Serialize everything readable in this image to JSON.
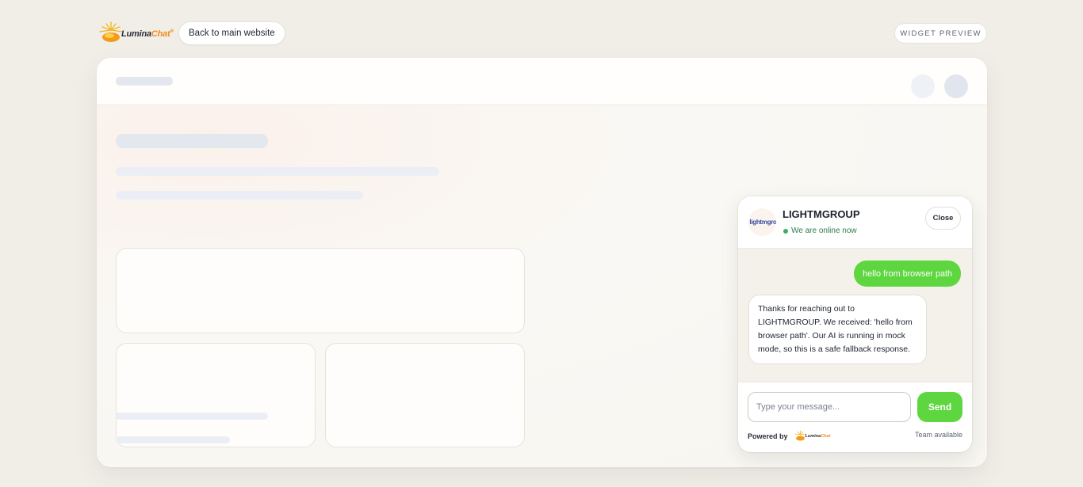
{
  "topbar": {
    "logo": {
      "part1": "Lumina",
      "part2": "Chat",
      "mark": "®"
    },
    "back_label": "Back to main website",
    "preview_label": "WIDGET PREVIEW"
  },
  "chat": {
    "brand_name": "LIGHTMGROUP",
    "avatar_text": "lightmgro",
    "status": "We are online now",
    "close_label": "Close",
    "messages": [
      {
        "role": "user",
        "text": "hello from browser path"
      },
      {
        "role": "bot",
        "text": "Thanks for reaching out to LIGHTMGROUP. We received: 'hello from browser path'. Our AI is running in mock mode, so this is a safe fallback response."
      }
    ],
    "input_placeholder": "Type your message...",
    "send_label": "Send",
    "powered_by": "Powered by",
    "team_status": "Team available"
  },
  "colors": {
    "accent_green": "#5dd63f",
    "online_green": "#35b265",
    "brand_orange": "#f08a1c",
    "background": "#f1eee8"
  },
  "icons": [
    "luminachat-logo",
    "status-dot-icon",
    "luminachat-mini-logo"
  ]
}
